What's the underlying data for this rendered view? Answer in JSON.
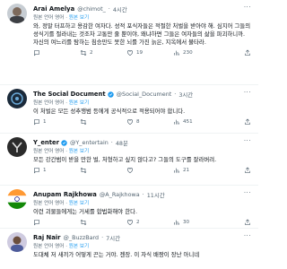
{
  "posts": [
    {
      "name": "Arai Amelya",
      "handle": "@chimot_",
      "time": "4시간",
      "translation_note": "원본 언어 영어",
      "translation_link": "원본 보기",
      "text": "와, 정말 터프하고 용감한 여자다. 성적 포식자들은 적절한 처벌을 받아야 해. 심지어 그들의 성식기를 절라내는 것조차 고통만 줄 뿐이야, 왜냐하면 그들은 여자들의 삶을 파괴하니까. 자신의 여느리를 탐하는 침승만도 못한 뇌를 가진 늙은, 지옥에서 불타라.",
      "replies": "",
      "reposts": "2",
      "likes": "19",
      "views": "230",
      "avatar_bg": "#8a95a3",
      "verified": false
    },
    {
      "name": "The Social Document",
      "handle": "@Social_Document",
      "time": "3시간",
      "translation_note": "원본 언어 영어",
      "translation_link": "원본 보기",
      "text": "이 처벌은 모든 성추행범 등에게 공식적으로 적용되어야 합니다.",
      "replies": "1",
      "reposts": "",
      "likes": "8",
      "views": "451",
      "avatar_bg": "#1b2a3a",
      "verified": true
    },
    {
      "name": "Y_enter",
      "handle": "@Y_entertain",
      "time": "48분",
      "translation_note": "원본 언어 영어",
      "translation_link": "원본 보기",
      "text": "모든 강간범이 받을 만한 벌, 처형하고 싶지 않다고? 그들의 도구를 잘라버려.",
      "replies": "1",
      "reposts": "",
      "likes": "",
      "views": "21",
      "avatar_bg": "#2b2b2b",
      "verified": true
    },
    {
      "name": "Anupam Rajkhowa",
      "handle": "@A_Rajkhowa",
      "time": "11시간",
      "translation_note": "원본 언어 영어",
      "translation_link": "원본 보기",
      "text": "이런 괴물들에게는 거세를 합법화해야 한다.",
      "replies": "",
      "reposts": "",
      "likes": "2",
      "views": "30",
      "avatar_bg": "#ffffff",
      "verified": false
    },
    {
      "name": "Raj Nair",
      "handle": "@_BuzzBard",
      "time": "7시간",
      "translation_note": "원본 언어 영어",
      "translation_link": "원본 보기",
      "text": "도대체 저 새끼가 어떻게 끈는 거야. 젠장. 이 자식 배짱이 장난 아니네",
      "replies": "",
      "reposts": "",
      "likes": "",
      "views": "",
      "avatar_bg": "#b9b6c9",
      "verified": false
    }
  ],
  "colors": {
    "link": "#1d9bf0",
    "muted": "#536471",
    "text": "#0f1419",
    "divider": "#eff3f4",
    "verified": "#1d9bf0"
  },
  "icons": [
    "more-icon",
    "reply-icon",
    "repost-icon",
    "like-icon",
    "views-icon",
    "bookmark-icon",
    "share-icon",
    "verified-badge-icon"
  ]
}
